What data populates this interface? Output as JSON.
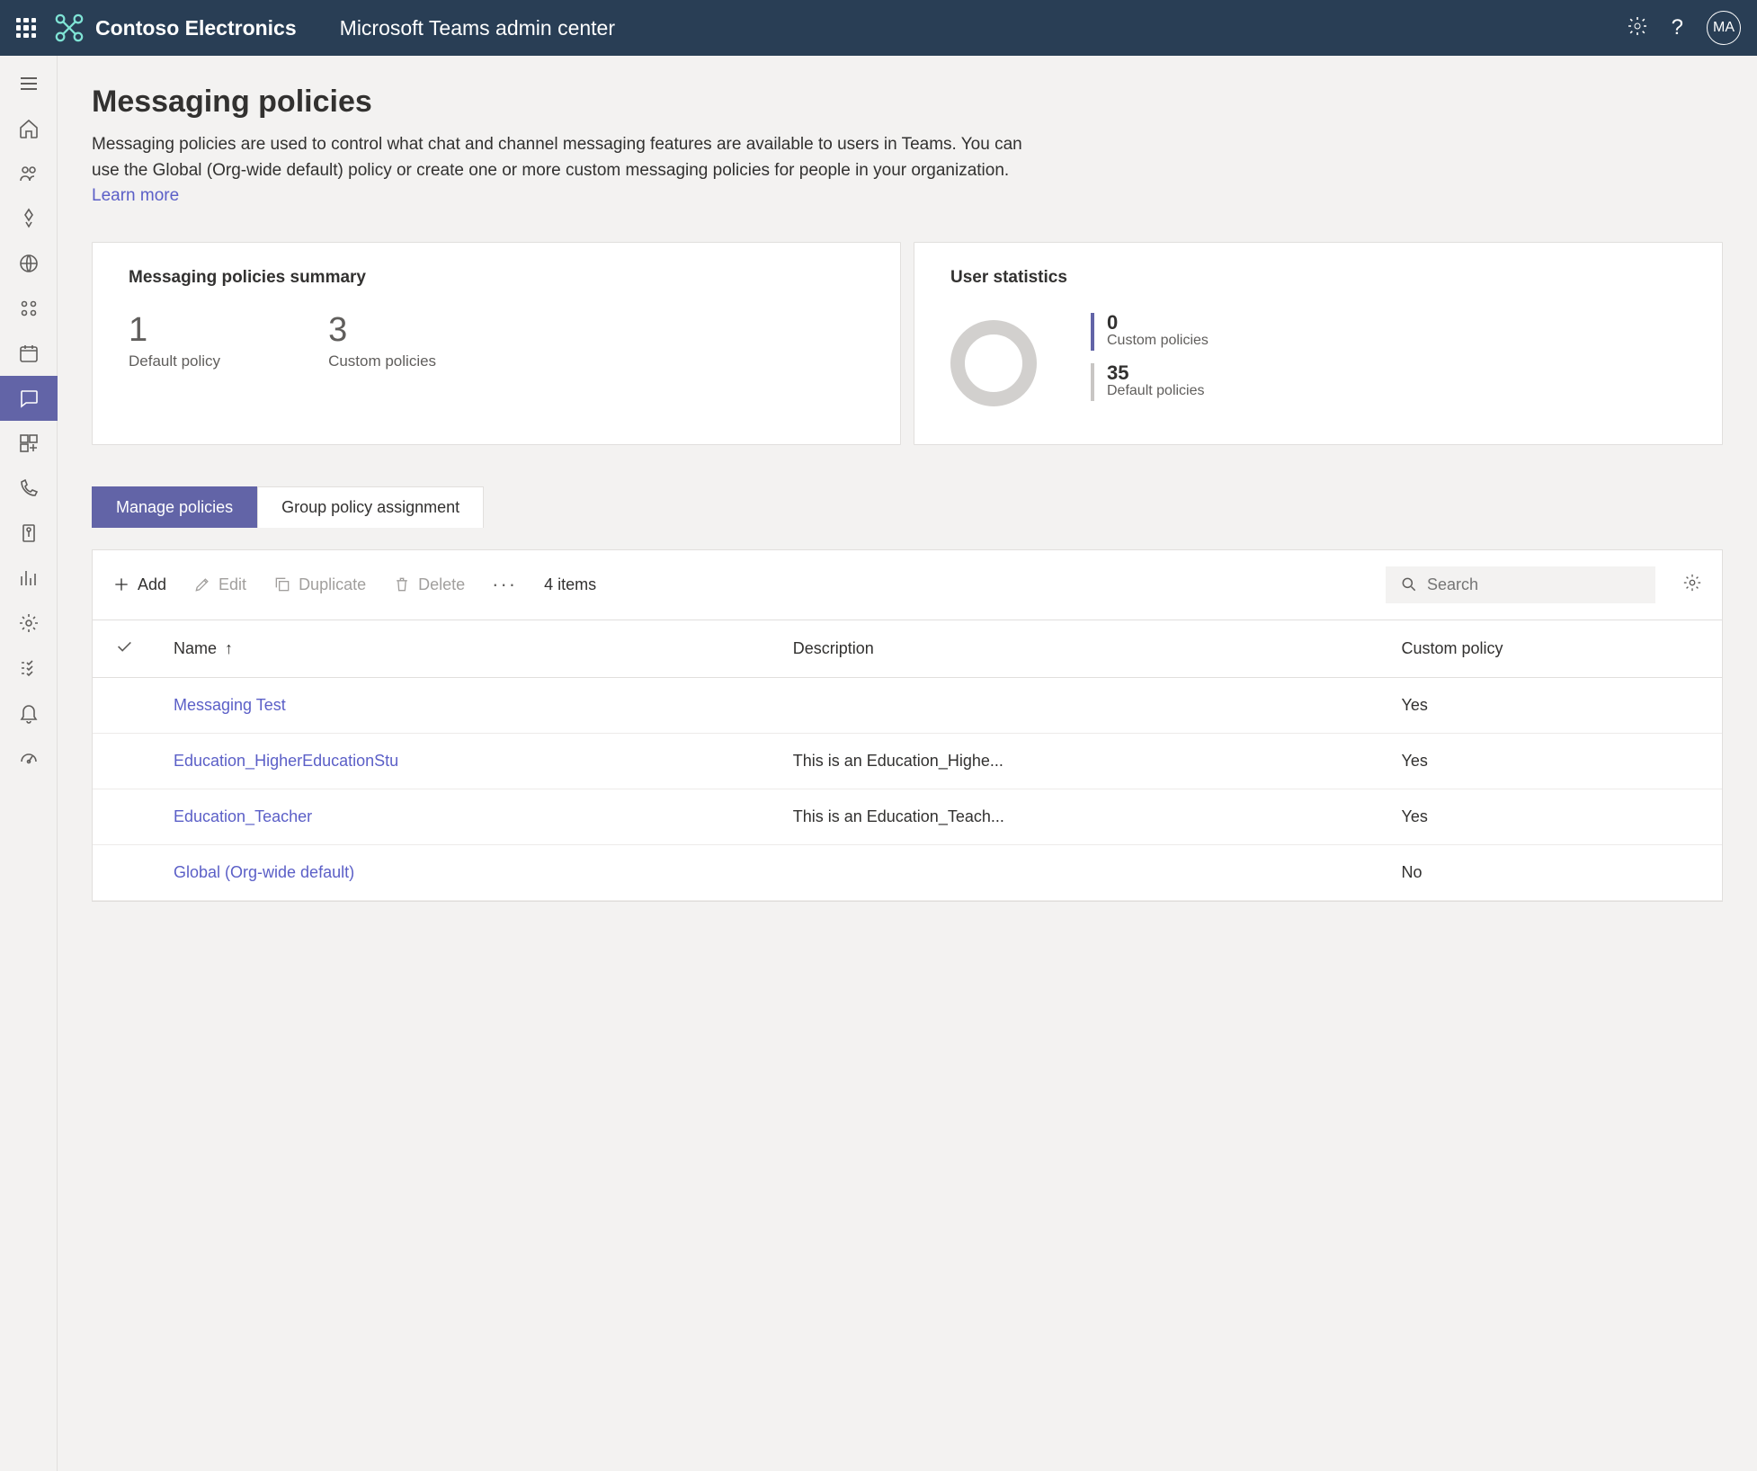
{
  "header": {
    "org_name": "Contoso Electronics",
    "app_title": "Microsoft Teams admin center",
    "avatar_initials": "MA"
  },
  "page": {
    "title": "Messaging policies",
    "description": "Messaging policies are used to control what chat and channel messaging features are available to users in Teams. You can use the Global (Org-wide default) policy or create one or more custom messaging policies for people in your organization. ",
    "learn_more": "Learn more"
  },
  "summary": {
    "title": "Messaging policies summary",
    "default_count": "1",
    "default_label": "Default policy",
    "custom_count": "3",
    "custom_label": "Custom policies"
  },
  "user_stats": {
    "title": "User statistics",
    "custom_count": "0",
    "custom_label": "Custom policies",
    "default_count": "35",
    "default_label": "Default policies"
  },
  "tabs": [
    {
      "label": "Manage policies",
      "active": true
    },
    {
      "label": "Group policy assignment",
      "active": false
    }
  ],
  "toolbar": {
    "add": "Add",
    "edit": "Edit",
    "duplicate": "Duplicate",
    "delete": "Delete",
    "item_count": "4 items",
    "search_placeholder": "Search"
  },
  "table": {
    "columns": {
      "name": "Name",
      "description": "Description",
      "custom": "Custom policy"
    },
    "rows": [
      {
        "name": "Messaging Test",
        "description": "",
        "custom": "Yes"
      },
      {
        "name": "Education_HigherEducationStu",
        "description": "This is an Education_Highe...",
        "custom": "Yes"
      },
      {
        "name": "Education_Teacher",
        "description": "This is an Education_Teach...",
        "custom": "Yes"
      },
      {
        "name": "Global (Org-wide default)",
        "description": "",
        "custom": "No"
      }
    ]
  }
}
